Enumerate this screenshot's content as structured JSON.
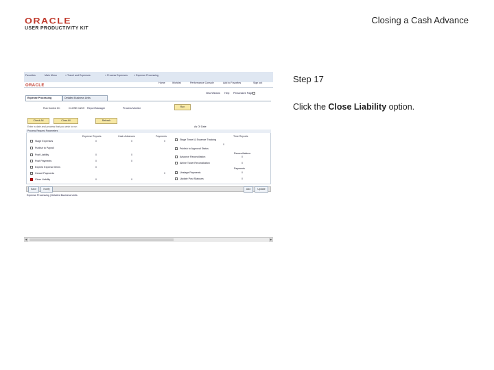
{
  "slide": {
    "logo_word": "ORACLE",
    "logo_sub": "USER PRODUCTIVITY KIT",
    "title": "Closing a Cash Advance",
    "step": "Step 17",
    "instruction_pre": "Click the ",
    "instruction_bold": "Close Liability",
    "instruction_post": " option."
  },
  "screenshot": {
    "topbar": {
      "crumbs": [
        "Favorites",
        "Main Menu",
        "> Travel and Expenses",
        "> Process Expenses",
        "> Expense Processing"
      ],
      "logo": "ORACLE",
      "links": [
        "Home",
        "Worklist",
        "Performance Console",
        "Add to Favorites",
        "Sign out"
      ],
      "new_window": "New Window",
      "help": "Help",
      "personalize": "Personalize Page"
    },
    "tabs": [
      "Expense Processing",
      "Detailed Business Units"
    ],
    "run_control": {
      "label": "Run Control ID:",
      "value": "CLOSE CASH",
      "report_manager": "Report Manager",
      "process_monitor": "Process Monitor",
      "run_button": "Run"
    },
    "buttons": {
      "check_all": "Check All",
      "clear_all": "Clear All",
      "refresh": "Refresh"
    },
    "hint": "Enter a date and process that you wish to run",
    "as_of": "As Of Date",
    "column_heads": [
      "Expense Reports",
      "Cash Advances",
      "Payments",
      "Time Reports"
    ],
    "section_title": "Process Request Parameters",
    "left_options": [
      {
        "label": "Stage Expenses",
        "values": [
          "0",
          "0",
          "0"
        ]
      },
      {
        "label": "Publish to Payroll",
        "values": [
          "",
          "",
          ""
        ]
      },
      {
        "label": "Post Liability",
        "values": [
          "0",
          "0",
          ""
        ]
      },
      {
        "label": "Post Payments",
        "values": [
          "0",
          "0",
          ""
        ]
      },
      {
        "label": "Expired Expense Items",
        "values": [
          "0",
          "",
          ""
        ]
      },
      {
        "label": "Cancel Payments",
        "values": [
          "",
          "",
          "0"
        ]
      },
      {
        "label": "Close Liability",
        "values": [
          "0",
          "0",
          ""
        ],
        "checked": true
      }
    ],
    "right_options": [
      {
        "label": "Stage Travel & Expense Tracking",
        "value": "0"
      },
      {
        "label": "Publish to Approval Status",
        "value": ""
      },
      {
        "label": "Advance Reconciliation",
        "value": "0"
      },
      {
        "label": "Airline Ticket Reconciliation",
        "value": "0"
      },
      {
        "label": "Unstage Payments",
        "value": "0"
      },
      {
        "label": "Update Post Statuses",
        "value": "0"
      }
    ],
    "right_heads": [
      "Reconciliations",
      "Payments"
    ],
    "bottom_buttons": {
      "save": "Save",
      "notify": "Notify",
      "add": "Add",
      "update": "Update"
    },
    "footer": "Expense Processing | Detailed Business Units"
  }
}
